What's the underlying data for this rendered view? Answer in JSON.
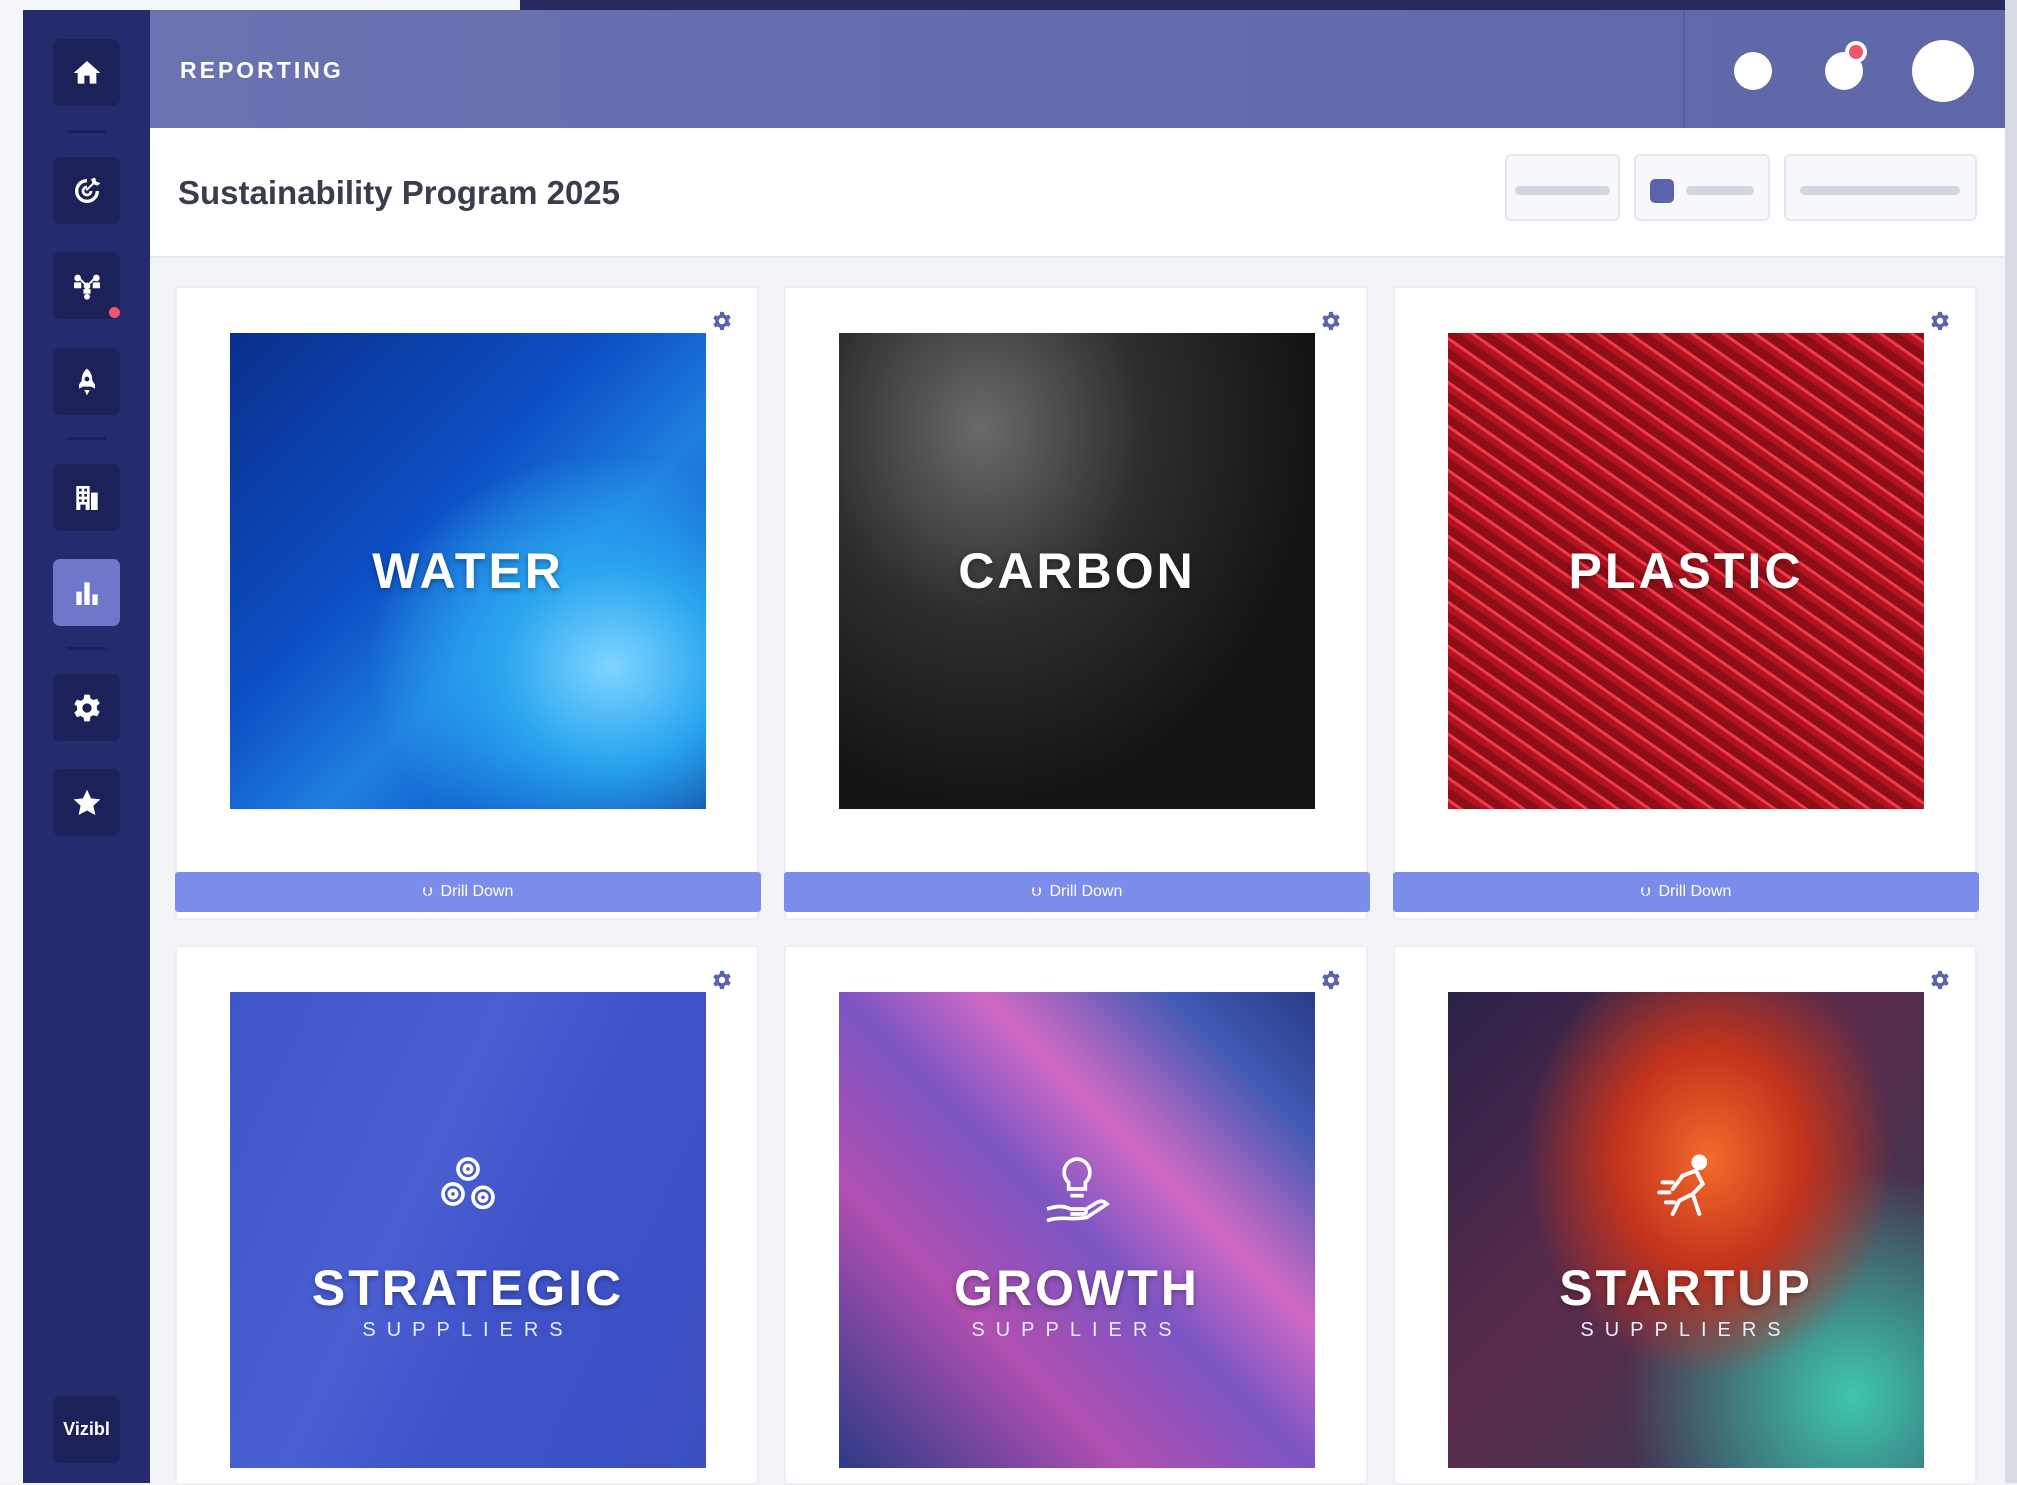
{
  "app": {
    "brand": "Vizibl"
  },
  "topbar": {
    "title": "REPORTING"
  },
  "header": {
    "page_title": "Sustainability Program 2025"
  },
  "sidebar": {
    "items": [
      {
        "name": "home",
        "icon": "home-icon",
        "active": false
      },
      {
        "name": "targets",
        "icon": "target-icon",
        "active": false
      },
      {
        "name": "network",
        "icon": "network-icon",
        "active": false,
        "badge": true
      },
      {
        "name": "innovation",
        "icon": "rocket-icon",
        "active": false
      },
      {
        "name": "companies",
        "icon": "building-icon",
        "active": false
      },
      {
        "name": "reporting",
        "icon": "bar-chart-icon",
        "active": true
      },
      {
        "name": "settings",
        "icon": "gear-icon",
        "active": false
      },
      {
        "name": "favourites",
        "icon": "star-icon",
        "active": false
      }
    ]
  },
  "cards": [
    {
      "title": "WATER",
      "subtitle": "",
      "drill_label": "Drill Down"
    },
    {
      "title": "CARBON",
      "subtitle": "",
      "drill_label": "Drill Down"
    },
    {
      "title": "PLASTIC",
      "subtitle": "",
      "drill_label": "Drill Down"
    },
    {
      "title": "STRATEGIC",
      "subtitle": "SUPPLIERS",
      "icon": "gears-icon"
    },
    {
      "title": "GROWTH",
      "subtitle": "SUPPLIERS",
      "icon": "lightbulb-hand-icon"
    },
    {
      "title": "STARTUP",
      "subtitle": "SUPPLIERS",
      "icon": "running-person-icon"
    }
  ],
  "colors": {
    "sidebar": "#252c6e",
    "topbar": "#636bad",
    "accent": "#7c8ceb",
    "badge": "#f1556b"
  }
}
